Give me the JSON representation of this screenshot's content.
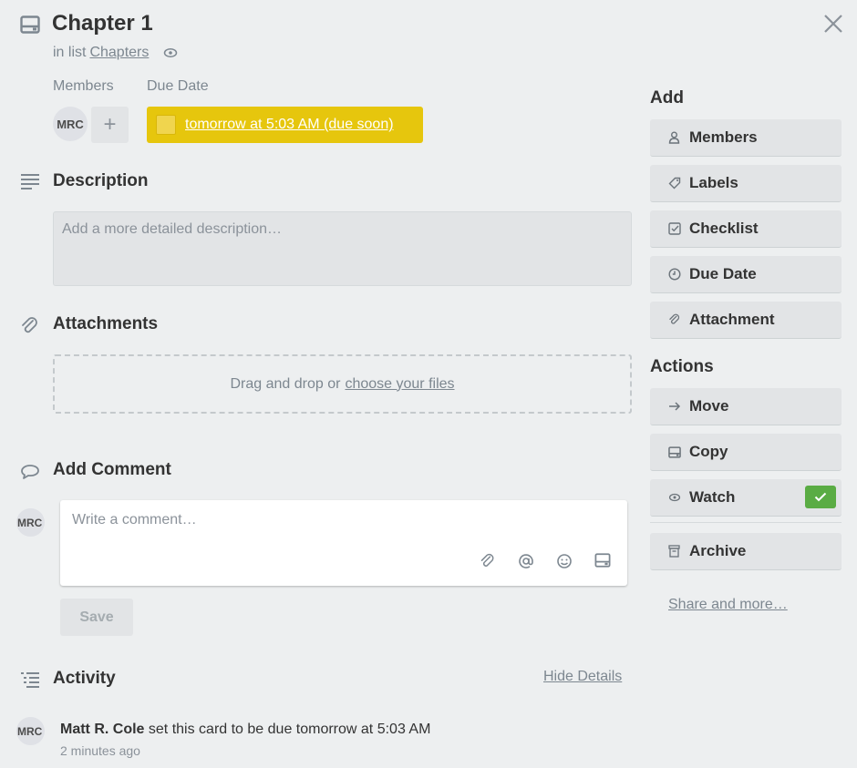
{
  "card": {
    "title": "Chapter 1",
    "list_prefix": "in list",
    "list_name": "Chapters"
  },
  "members": {
    "label": "Members",
    "avatar_initials": "MRC",
    "add_symbol": "+"
  },
  "due": {
    "label": "Due Date",
    "text": "tomorrow at 5:03 AM (due soon)",
    "color": "#e6c60d"
  },
  "description": {
    "title": "Description",
    "placeholder": "Add a more detailed description…"
  },
  "attachments": {
    "title": "Attachments",
    "drop_text": "Drag and drop or",
    "choose_link": "choose your files"
  },
  "comment": {
    "title": "Add Comment",
    "avatar_initials": "MRC",
    "placeholder": "Write a comment…",
    "save_label": "Save",
    "tools": [
      "paperclip-icon",
      "at-icon",
      "smiley-icon",
      "card-icon"
    ]
  },
  "activity": {
    "title": "Activity",
    "hide_details": "Hide Details",
    "items": [
      {
        "avatar_initials": "MRC",
        "user": "Matt R. Cole",
        "action": "set this card to be due tomorrow at 5:03 AM",
        "time": "2 minutes ago"
      }
    ]
  },
  "sidebar": {
    "add_heading": "Add",
    "add_buttons": [
      {
        "label": "Members",
        "icon": "person-icon"
      },
      {
        "label": "Labels",
        "icon": "tag-icon"
      },
      {
        "label": "Checklist",
        "icon": "checkbox-icon"
      },
      {
        "label": "Due Date",
        "icon": "clock-icon"
      },
      {
        "label": "Attachment",
        "icon": "paperclip-icon"
      }
    ],
    "actions_heading": "Actions",
    "action_buttons": [
      {
        "label": "Move",
        "icon": "arrow-right-icon"
      },
      {
        "label": "Copy",
        "icon": "card-icon"
      },
      {
        "label": "Watch",
        "icon": "eye-icon",
        "checked": true
      },
      {
        "label": "Archive",
        "icon": "archive-icon"
      }
    ],
    "share_more": "Share and more…",
    "watch_check_color": "#5aac44"
  }
}
